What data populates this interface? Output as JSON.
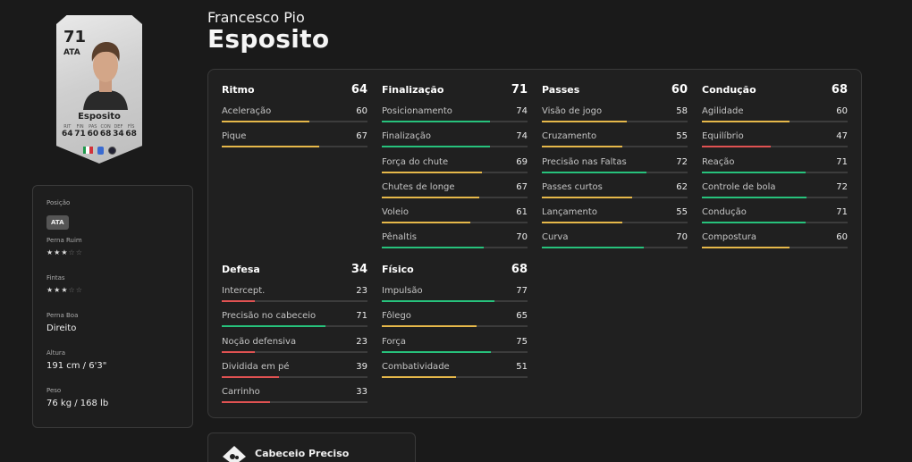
{
  "player": {
    "first_name": "Francesco Pio",
    "last_name": "Esposito"
  },
  "card": {
    "rating": "71",
    "position": "ATA",
    "name": "Esposito",
    "stats": [
      {
        "label": "RIT",
        "value": "64"
      },
      {
        "label": "FIN",
        "value": "71"
      },
      {
        "label": "PAS",
        "value": "60"
      },
      {
        "label": "CON",
        "value": "68"
      },
      {
        "label": "DEF",
        "value": "34"
      },
      {
        "label": "FÍS",
        "value": "68"
      }
    ]
  },
  "info": {
    "position_label": "Posição",
    "position_value": "ATA",
    "weak_foot_label": "Perna Ruim",
    "weak_foot_stars": 3,
    "skills_label": "Fintas",
    "skills_stars": 3,
    "preferred_foot_label": "Perna Boa",
    "preferred_foot_value": "Direito",
    "height_label": "Altura",
    "height_value": "191 cm / 6'3\"",
    "weight_label": "Peso",
    "weight_value": "76 kg / 168 lb"
  },
  "colors": {
    "high": "#27c27c",
    "mid": "#e6b84a",
    "low": "#e05252"
  },
  "categories": [
    {
      "name": "Ritmo",
      "value": "64",
      "stats": [
        {
          "name": "Aceleração",
          "value": 60
        },
        {
          "name": "Pique",
          "value": 67
        }
      ]
    },
    {
      "name": "Finalização",
      "value": "71",
      "stats": [
        {
          "name": "Posicionamento",
          "value": 74
        },
        {
          "name": "Finalização",
          "value": 74
        },
        {
          "name": "Força do chute",
          "value": 69
        },
        {
          "name": "Chutes de longe",
          "value": 67
        },
        {
          "name": "Voleio",
          "value": 61
        },
        {
          "name": "Pênaltis",
          "value": 70
        }
      ]
    },
    {
      "name": "Passes",
      "value": "60",
      "stats": [
        {
          "name": "Visão de jogo",
          "value": 58
        },
        {
          "name": "Cruzamento",
          "value": 55
        },
        {
          "name": "Precisão nas Faltas",
          "value": 72
        },
        {
          "name": "Passes curtos",
          "value": 62
        },
        {
          "name": "Lançamento",
          "value": 55
        },
        {
          "name": "Curva",
          "value": 70
        }
      ]
    },
    {
      "name": "Condução",
      "value": "68",
      "stats": [
        {
          "name": "Agilidade",
          "value": 60
        },
        {
          "name": "Equilíbrio",
          "value": 47
        },
        {
          "name": "Reação",
          "value": 71
        },
        {
          "name": "Controle de bola",
          "value": 72
        },
        {
          "name": "Condução",
          "value": 71
        },
        {
          "name": "Compostura",
          "value": 60
        }
      ]
    },
    {
      "name": "Defesa",
      "value": "34",
      "stats": [
        {
          "name": "Intercept.",
          "value": 23
        },
        {
          "name": "Precisão no cabeceio",
          "value": 71
        },
        {
          "name": "Noção defensiva",
          "value": 23
        },
        {
          "name": "Dividida em pé",
          "value": 39
        },
        {
          "name": "Carrinho",
          "value": 33
        }
      ]
    },
    {
      "name": "Físico",
      "value": "68",
      "stats": [
        {
          "name": "Impulsão",
          "value": 77
        },
        {
          "name": "Fôlego",
          "value": 65
        },
        {
          "name": "Força",
          "value": 75
        },
        {
          "name": "Combatividade",
          "value": 51
        }
      ]
    }
  ],
  "playstyle": {
    "name": "Cabeceio Preciso",
    "icon": "header-playstyle-icon"
  }
}
